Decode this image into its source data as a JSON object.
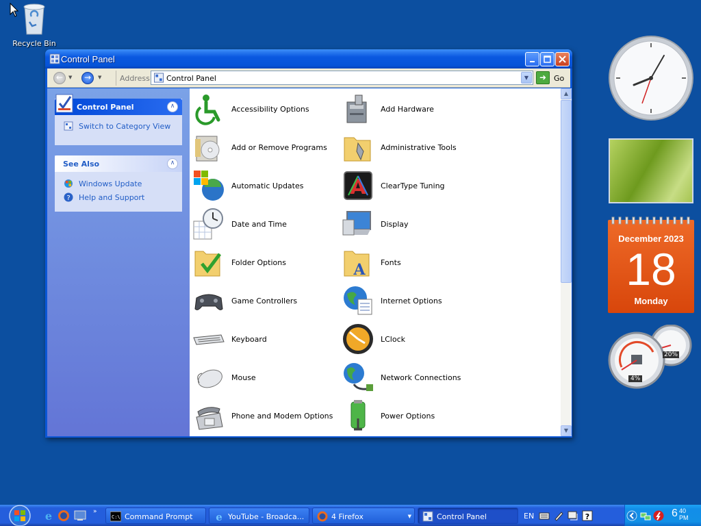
{
  "desktop": {
    "recycle_bin_label": "Recycle Bin"
  },
  "window": {
    "title": "Control Panel",
    "toolbar": {
      "address_label": "Address",
      "address_value": "Control Panel",
      "go_label": "Go"
    },
    "left_pane": {
      "control_panel": {
        "title": "Control Panel",
        "links": [
          {
            "label": "Switch to Category View",
            "icon": "category-view-icon"
          }
        ]
      },
      "see_also": {
        "title": "See Also",
        "links": [
          {
            "label": "Windows Update",
            "icon": "windows-update-icon"
          },
          {
            "label": "Help and Support",
            "icon": "help-icon"
          }
        ]
      }
    },
    "items": [
      {
        "label": "Accessibility Options",
        "icon": "accessibility-icon"
      },
      {
        "label": "Add Hardware",
        "icon": "add-hardware-icon"
      },
      {
        "label": "Add or Remove Programs",
        "icon": "add-remove-programs-icon"
      },
      {
        "label": "Administrative Tools",
        "icon": "administrative-tools-icon"
      },
      {
        "label": "Automatic Updates",
        "icon": "automatic-updates-icon"
      },
      {
        "label": "ClearType Tuning",
        "icon": "cleartype-icon"
      },
      {
        "label": "Date and Time",
        "icon": "date-time-icon"
      },
      {
        "label": "Display",
        "icon": "display-icon"
      },
      {
        "label": "Folder Options",
        "icon": "folder-options-icon"
      },
      {
        "label": "Fonts",
        "icon": "fonts-icon"
      },
      {
        "label": "Game Controllers",
        "icon": "game-controllers-icon"
      },
      {
        "label": "Internet Options",
        "icon": "internet-options-icon"
      },
      {
        "label": "Keyboard",
        "icon": "keyboard-icon"
      },
      {
        "label": "LClock",
        "icon": "lclock-icon"
      },
      {
        "label": "Mouse",
        "icon": "mouse-icon"
      },
      {
        "label": "Network Connections",
        "icon": "network-connections-icon"
      },
      {
        "label": "Phone and Modem Options",
        "icon": "phone-modem-icon"
      },
      {
        "label": "Power Options",
        "icon": "power-options-icon"
      }
    ]
  },
  "gadgets": {
    "calendar": {
      "month_year": "December 2023",
      "day": "18",
      "weekday": "Monday"
    },
    "meters": {
      "cpu": "4%",
      "memory": "20%"
    }
  },
  "taskbar": {
    "tasks": [
      {
        "label": "Command Prompt",
        "icon": "cmd-icon"
      },
      {
        "label": "YouTube - Broadca...",
        "icon": "ie-icon"
      },
      {
        "label": "4 Firefox",
        "icon": "firefox-icon"
      },
      {
        "label": "Control Panel",
        "icon": "control-panel-icon"
      }
    ],
    "language": "EN",
    "clock": {
      "hour": "6",
      "minute": "40",
      "ampm": "PM"
    }
  },
  "colors": {
    "desktop": "#0c4fa0",
    "titlebar": "#0a58e0",
    "left_pane": "#7ba2e7",
    "calendar": "#e4591a",
    "taskbar": "#245edc"
  }
}
